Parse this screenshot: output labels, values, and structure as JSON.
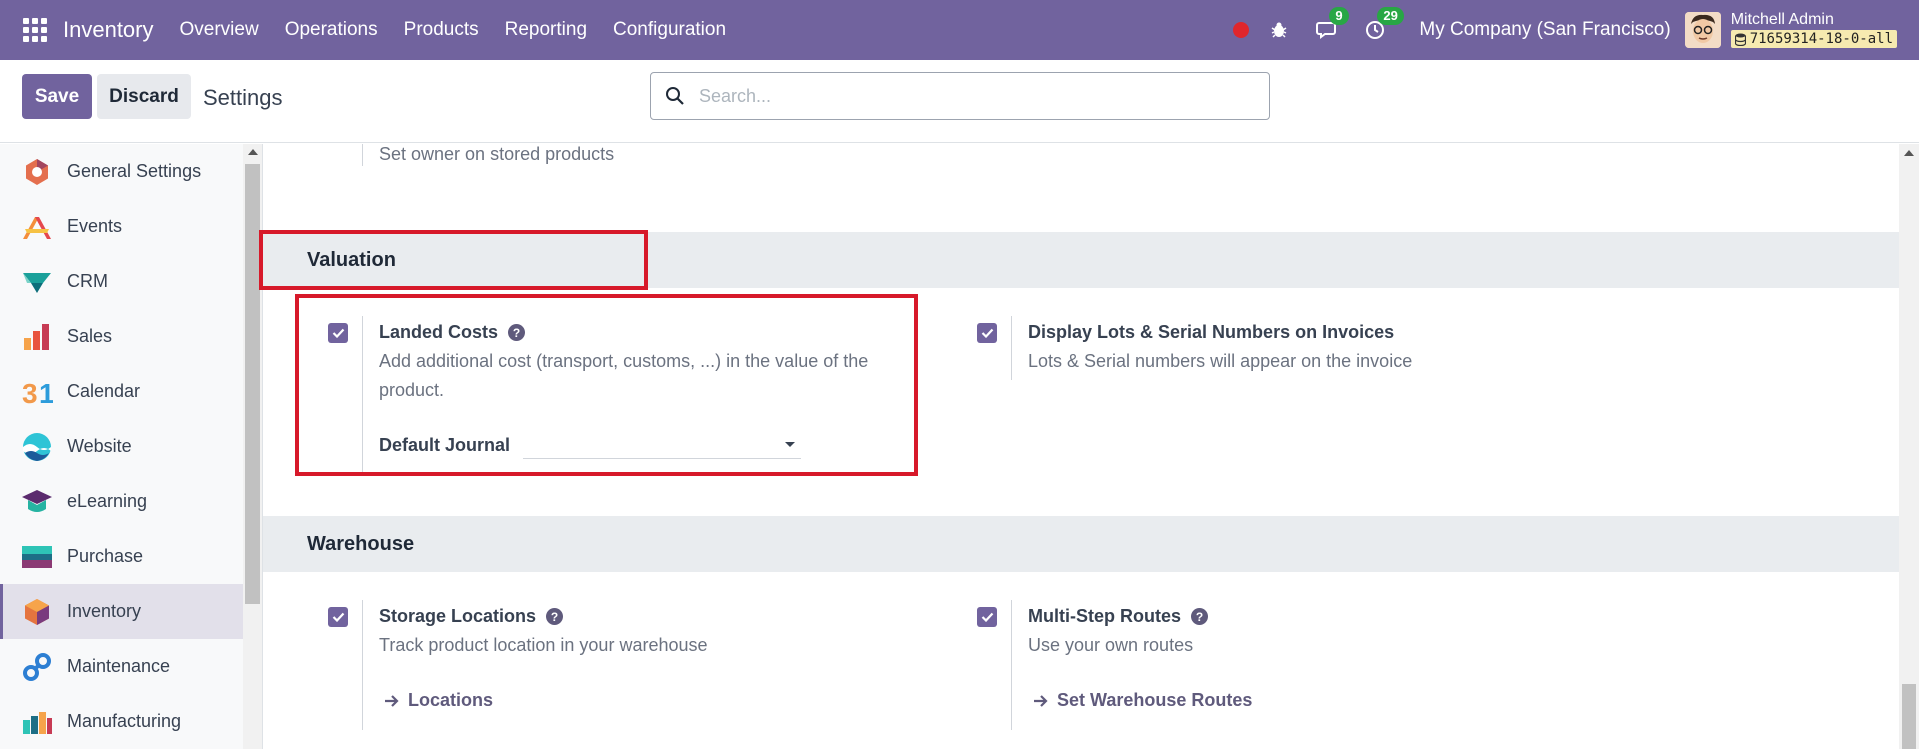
{
  "navbar": {
    "brand": "Inventory",
    "menu": [
      "Overview",
      "Operations",
      "Products",
      "Reporting",
      "Configuration"
    ],
    "messages_count": "9",
    "activities_count": "29",
    "company": "My Company (San Francisco)",
    "user_name": "Mitchell Admin",
    "db_name": "71659314-18-0-all"
  },
  "controlbar": {
    "save_label": "Save",
    "discard_label": "Discard",
    "title": "Settings",
    "search_placeholder": "Search..."
  },
  "sidebar": {
    "items": [
      {
        "label": "General Settings",
        "icon": "general-settings-icon"
      },
      {
        "label": "Events",
        "icon": "events-icon"
      },
      {
        "label": "CRM",
        "icon": "crm-icon"
      },
      {
        "label": "Sales",
        "icon": "sales-icon"
      },
      {
        "label": "Calendar",
        "icon": "calendar-icon"
      },
      {
        "label": "Website",
        "icon": "website-icon"
      },
      {
        "label": "eLearning",
        "icon": "elearning-icon"
      },
      {
        "label": "Purchase",
        "icon": "purchase-icon"
      },
      {
        "label": "Inventory",
        "icon": "inventory-icon",
        "active": true
      },
      {
        "label": "Maintenance",
        "icon": "maintenance-icon"
      },
      {
        "label": "Manufacturing",
        "icon": "manufacturing-icon"
      }
    ]
  },
  "content": {
    "top_desc": "Set owner on stored products",
    "valuation": {
      "header": "Valuation",
      "landed_costs": {
        "title": "Landed Costs",
        "desc": "Add additional cost (transport, customs, ...) in the value of the product.",
        "journal_label": "Default Journal",
        "journal_value": "",
        "checked": true
      },
      "lots_invoices": {
        "title": "Display Lots & Serial Numbers on Invoices",
        "desc": "Lots & Serial numbers will appear on the invoice",
        "checked": true
      }
    },
    "warehouse": {
      "header": "Warehouse",
      "storage_locations": {
        "title": "Storage Locations",
        "desc": "Track product location in your warehouse",
        "link": "Locations",
        "checked": true
      },
      "multi_step": {
        "title": "Multi-Step Routes",
        "desc": "Use your own routes",
        "link": "Set Warehouse Routes",
        "checked": true
      }
    }
  },
  "colors": {
    "brand": "#71639e",
    "highlight": "#d7192a",
    "badge": "#28a745"
  }
}
